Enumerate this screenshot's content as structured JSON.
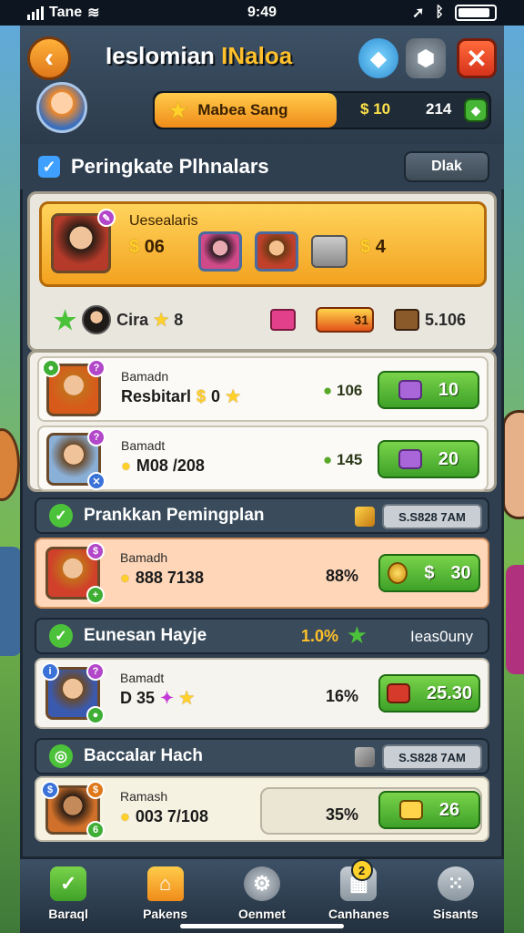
{
  "status": {
    "carrier": "Tane",
    "time": "9:49"
  },
  "header": {
    "title_part1": "Ieslomian ",
    "title_part2": "INaloa",
    "rank_label": "Mabea Sang",
    "coins": "10",
    "score": "214"
  },
  "section": {
    "title": "Peringkate Plhnalars",
    "button": "Dlak"
  },
  "featured": {
    "name": "Uesealaris",
    "coins1": "06",
    "coins2": "4"
  },
  "stats": {
    "player": "Cira",
    "stars": "8",
    "chest_label": "31",
    "total": "5.106"
  },
  "players": [
    {
      "name": "Bamadn",
      "detail": "Resbitarl",
      "detail_coin": "0",
      "score": "106",
      "button": "10"
    },
    {
      "name": "Bamadt",
      "detail": "M08 /208",
      "score": "145",
      "button": "20"
    }
  ],
  "sections": [
    {
      "title": "Prankkan Pemingplan",
      "timer": "S.S828 7AM"
    },
    {
      "title": "Eunesan Hayje",
      "percent": "1.0%",
      "alt": "Ieas0uny"
    },
    {
      "title": "Baccalar Hach",
      "timer": "S.S828 7AM"
    }
  ],
  "rows": [
    {
      "name": "Bamadh",
      "detail": "888 7138",
      "percent": "88%",
      "button": "30"
    },
    {
      "name": "Bamadt",
      "detail": "D 35",
      "percent": "16%",
      "button": "25.30"
    },
    {
      "name": "Ramash",
      "detail": "003 7/108",
      "percent": "35%",
      "button": "26"
    }
  ],
  "nav": [
    {
      "label": "Baraql",
      "icon": "check-icon"
    },
    {
      "label": "Pakens",
      "icon": "home-icon"
    },
    {
      "label": "Oenmet",
      "icon": "gear-icon"
    },
    {
      "label": "Canhanes",
      "icon": "box-icon",
      "badge": "2"
    },
    {
      "label": "Sisants",
      "icon": "dots-icon"
    }
  ]
}
